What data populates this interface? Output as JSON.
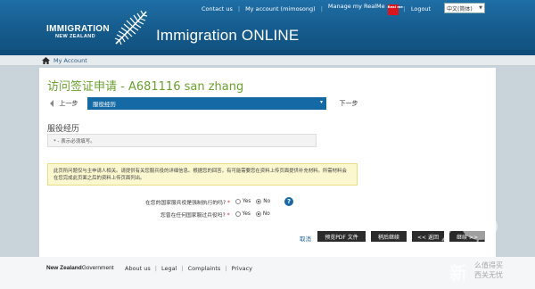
{
  "colors": {
    "header_blue": "#1f6ea6",
    "title_green": "#6aa12e",
    "step_blue": "#156aa5",
    "button_dark": "#2b2b2b",
    "info_yellow": "#fbf8cf"
  },
  "topnav": {
    "contact": "Contact us",
    "account": "My account (mimosong)",
    "realme": "Manage my RealMe",
    "realme_badge": "Real me",
    "logout": "Logout",
    "language": "中文(简体)"
  },
  "logo": {
    "line1": "IMMIGRATION",
    "line2": "NEW ZEALAND",
    "icon": "silver-fern-icon"
  },
  "app_title": "Immigration ONLINE",
  "breadcrumb": {
    "home_icon": "home-icon",
    "label": "My Account"
  },
  "page": {
    "title": "访问签证申请 - A681116 san zhang",
    "prev_step": "上一步",
    "current_step": "服役经历",
    "next_step": "下一步",
    "section_title": "服役经历",
    "required_note": "* - 表示必须填写。",
    "info_text": "此页所问题仅与主申请人相关。请提供有关您服兵役的详细信息。根据您的回答，有可能需要您在资料上传页面提供补充材料。所需材料会在您完成此页面之后的资料上传页面列出。",
    "questions": [
      {
        "label": "在您的国家服兵役是强制执行的吗?",
        "yes": "Yes",
        "no": "No",
        "selected": "No"
      },
      {
        "label": "您曾在任何国家服过兵役吗?",
        "yes": "Yes",
        "no": "No",
        "selected": "No"
      }
    ],
    "help_icon": "help-icon",
    "cancel": "取消",
    "buttons": {
      "preview_pdf": "预览PDF 文件",
      "save_continue": "稍后继续",
      "back": "<< 返回",
      "next": "继续 >>"
    }
  },
  "footer": {
    "gov_bold": "New Zealand",
    "gov_rest": "Government",
    "links": [
      "About us",
      "Legal",
      "Complaints",
      "Privacy"
    ]
  },
  "watermark": {
    "icon": "kiwi-icon",
    "char": "新",
    "tag1": "么值得买",
    "tag2": "西关无忧"
  }
}
